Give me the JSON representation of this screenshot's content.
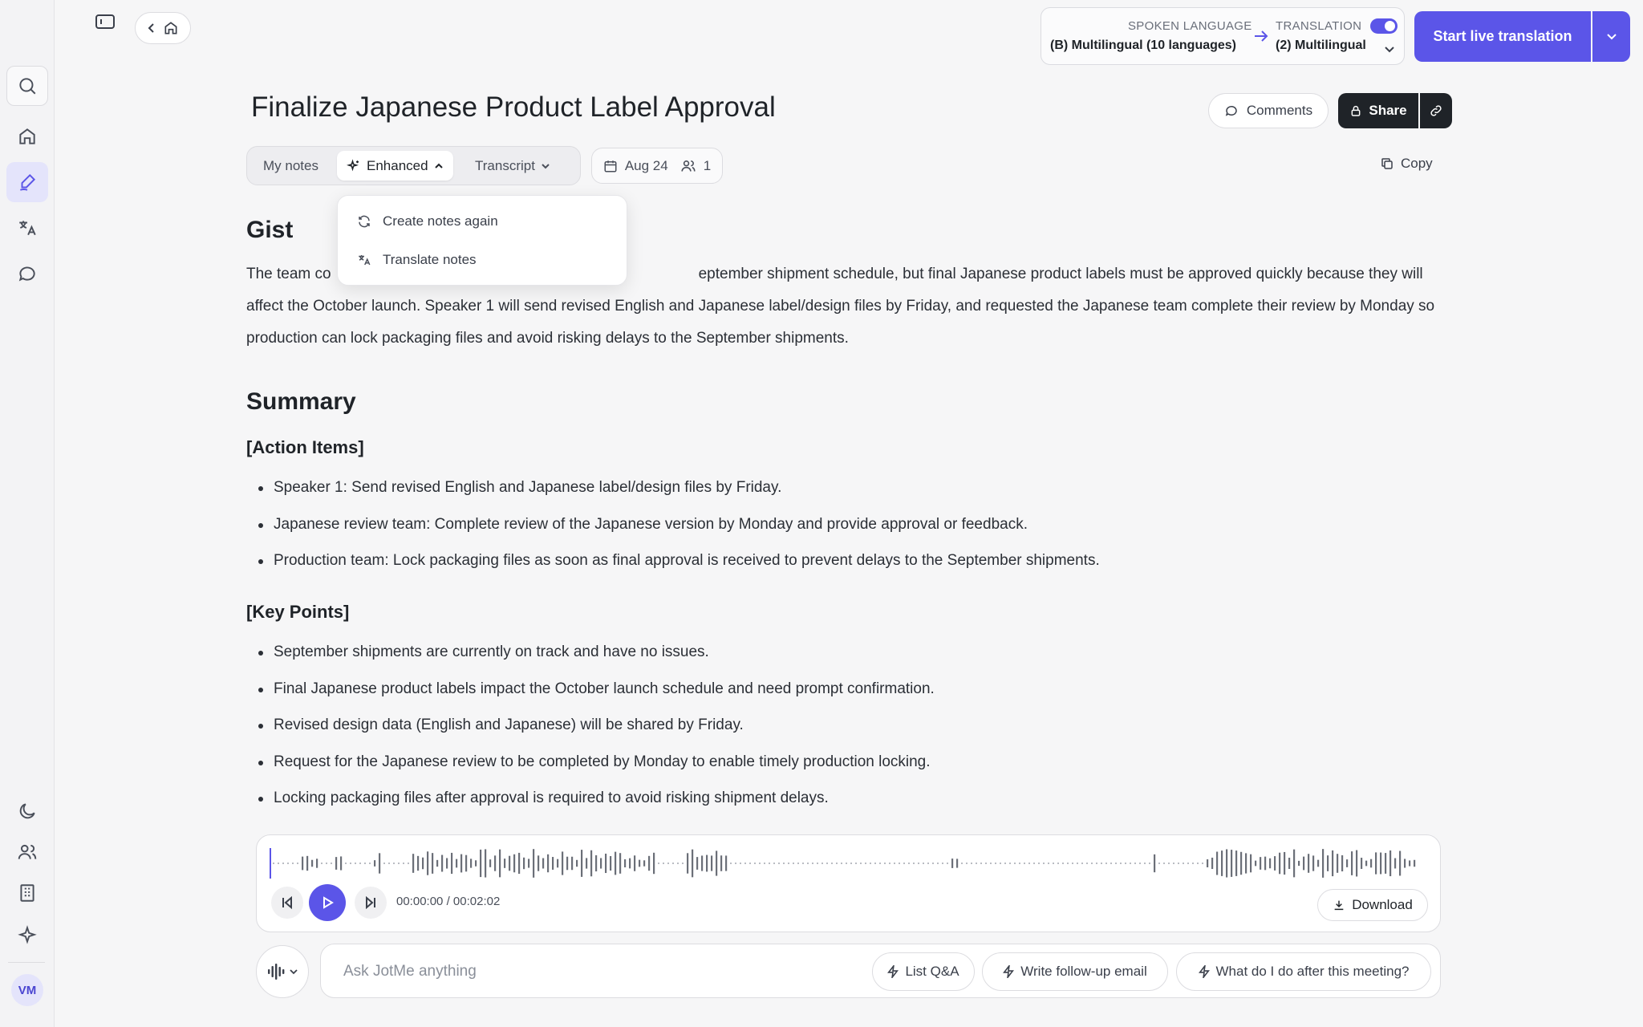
{
  "header": {
    "spoken_language_label": "SPOKEN LANGUAGE",
    "spoken_language_value": "(B) Multilingual (10 languages)",
    "translation_label": "TRANSLATION",
    "translation_value": "(2) Multilingual",
    "translation_enabled": true,
    "start_button": "Start live translation"
  },
  "note": {
    "title": "Finalize Japanese Product Label Approval",
    "comments": "Comments",
    "share": "Share",
    "copy": "Copy",
    "tabs": [
      "My notes",
      "Enhanced",
      "Transcript"
    ],
    "active_tab": "Enhanced",
    "date": "Aug 24",
    "participants": "1"
  },
  "menu": {
    "items": [
      "Create notes again",
      "Translate notes"
    ]
  },
  "gist": {
    "heading": "Gist",
    "visible_start": "The team co",
    "visible_rest": "eptember shipment schedule, but final Japanese product labels must be approved quickly because they will affect the October launch. Speaker 1 will send revised English and Japanese label/design files by Friday, and requested the Japanese team complete their review by Monday so production can lock packaging files and avoid risking delays to the September shipments."
  },
  "summary": {
    "heading": "Summary",
    "action_items_heading": "[Action Items]",
    "action_items": [
      "Speaker 1: Send revised English and Japanese label/design files by Friday.",
      "Japanese review team: Complete review of the Japanese version by Monday and provide approval or feedback.",
      "Production team: Lock packaging files as soon as final approval is received to prevent delays to the September shipments."
    ],
    "key_points_heading": "[Key Points]",
    "key_points": [
      "September shipments are currently on track and have no issues.",
      "Final Japanese product labels impact the October launch schedule and need prompt confirmation.",
      "Revised design data (English and Japanese) will be shared by Friday.",
      "Request for the Japanese review to be completed by Monday to enable timely production locking.",
      "Locking packaging files after approval is required to avoid risking shipment delays."
    ]
  },
  "player": {
    "current_time": "00:00:00",
    "separator": "/",
    "duration": "00:02:02",
    "download": "Download"
  },
  "ask": {
    "placeholder": "Ask JotMe anything",
    "chips": [
      "List Q&A",
      "Write follow-up email",
      "What do I do after this meeting?"
    ]
  },
  "user": {
    "initials": "VM"
  },
  "colors": {
    "accent": "#5b55e8",
    "dark": "#1f2328"
  }
}
